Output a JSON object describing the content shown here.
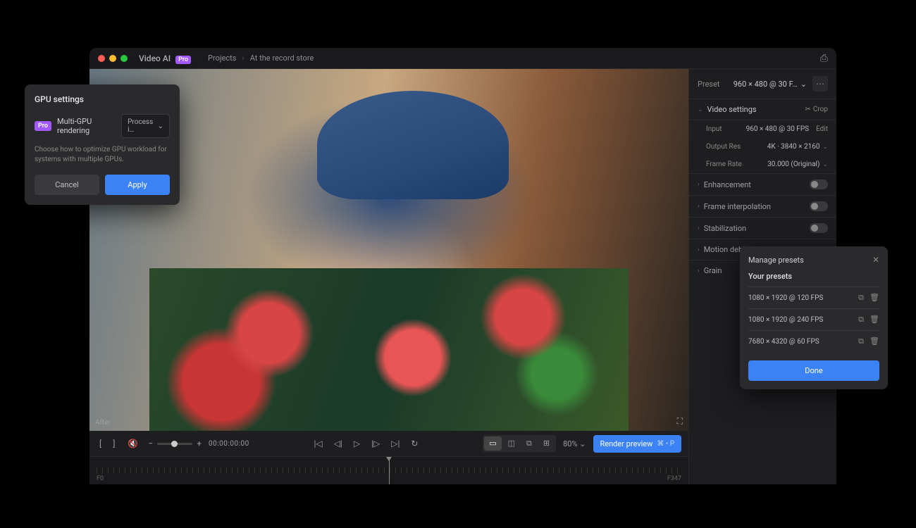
{
  "app": {
    "name": "Video AI",
    "badge": "Pro"
  },
  "breadcrumb": {
    "root": "Projects",
    "current": "At the record store"
  },
  "preview": {
    "label": "After"
  },
  "playbar": {
    "timecode": "00:00:00:00",
    "zoom_pct": "80%",
    "render_label": "Render preview",
    "render_shortcut": "⌘ • P"
  },
  "timeline": {
    "start": "F0",
    "end": "F347"
  },
  "preset_row": {
    "label": "Preset",
    "value": "960 × 480 @ 30 F…"
  },
  "video_settings": {
    "title": "Video settings",
    "crop": "Crop",
    "rows": [
      {
        "label": "Input",
        "value": "960 × 480 @ 30 FPS",
        "edit": "Edit"
      },
      {
        "label": "Output Res",
        "value": "4K · 3840 × 2160",
        "dropdown": true
      },
      {
        "label": "Frame Rate",
        "value": "30.000 (Original)",
        "dropdown": true
      }
    ]
  },
  "sections": [
    {
      "title": "Enhancement"
    },
    {
      "title": "Frame interpolation"
    },
    {
      "title": "Stabilization"
    },
    {
      "title": "Motion deblur"
    },
    {
      "title": "Grain"
    }
  ],
  "gpu_modal": {
    "title": "GPU settings",
    "badge": "Pro",
    "label": "Multi-GPU rendering",
    "select": "Process i…",
    "desc": "Choose how to optimize GPU workload for systems with multiple GPUs.",
    "cancel": "Cancel",
    "apply": "Apply"
  },
  "presets_popover": {
    "title": "Manage presets",
    "subtitle": "Your presets",
    "items": [
      "1080 × 1920 @ 120 FPS",
      "1080 × 1920 @ 240 FPS",
      "7680 × 4320 @ 60 FPS"
    ],
    "done": "Done"
  }
}
